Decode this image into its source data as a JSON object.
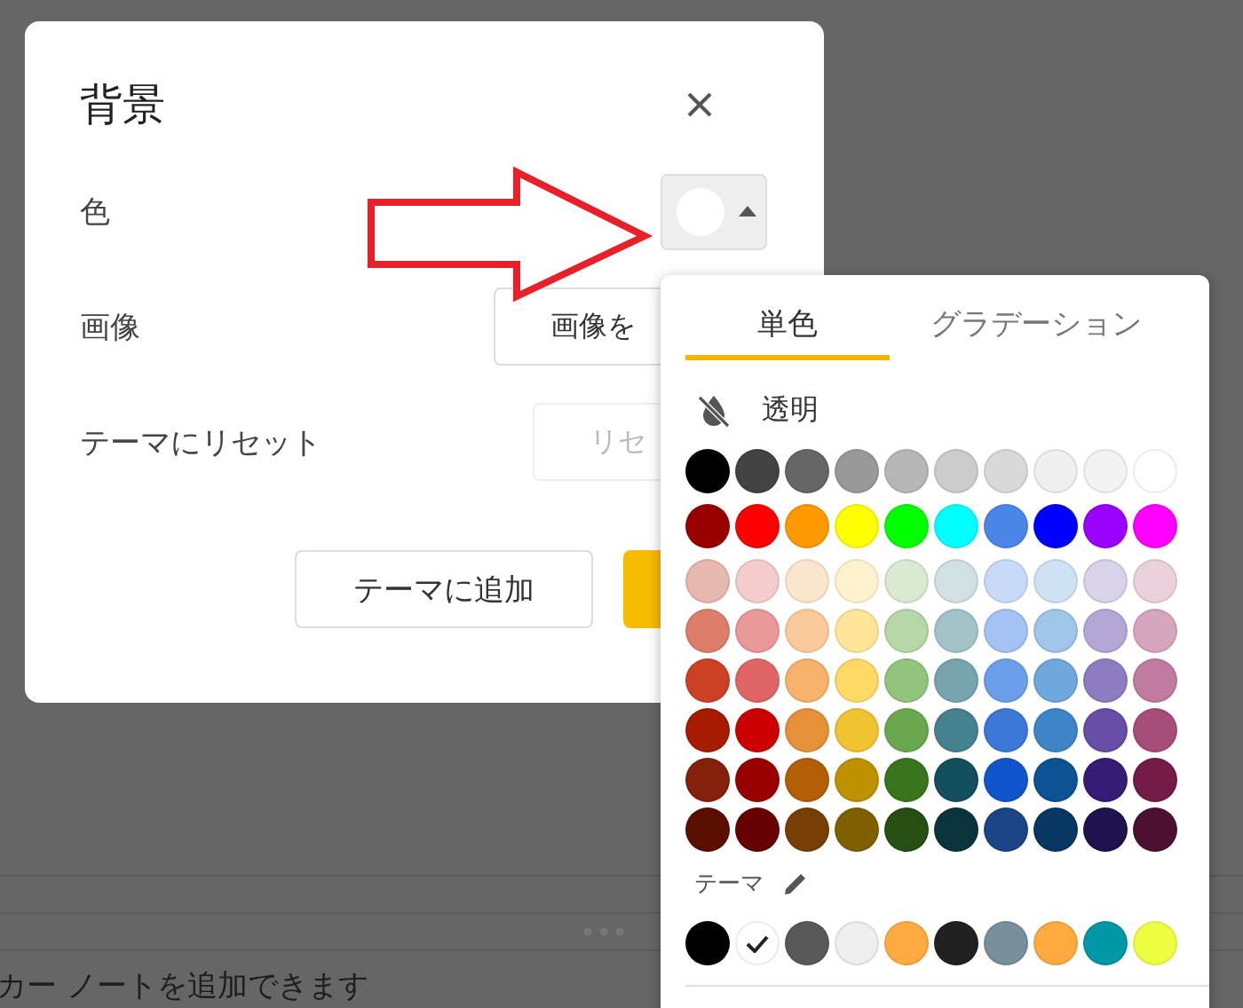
{
  "background_page": {
    "note_text": "カー ノートを追加できます"
  },
  "dialog": {
    "title": "背景",
    "rows": [
      {
        "kind": "color",
        "label": "色"
      },
      {
        "kind": "button",
        "label": "画像",
        "button": "画像を"
      },
      {
        "kind": "disabled-button",
        "label": "テーマにリセット",
        "button": "リセ"
      }
    ],
    "current_color": {
      "color": "#ffffff",
      "expanded": true
    },
    "footer_buttons": [
      {
        "label": "テーマに追加",
        "kind": "secondary"
      },
      {
        "kind": "primary"
      }
    ]
  },
  "palette": {
    "tabs": [
      {
        "label": "単色",
        "selected": true
      },
      {
        "label": "グラデーション",
        "selected": false
      }
    ],
    "transparent_label": "透明",
    "rows": [
      {
        "swatches": [
          {
            "color": "#000000"
          },
          {
            "color": "#434343"
          },
          {
            "color": "#666666"
          },
          {
            "color": "#999999"
          },
          {
            "color": "#b7b7b7"
          },
          {
            "color": "#cccccc"
          },
          {
            "color": "#d9d9d9"
          },
          {
            "color": "#efefef"
          },
          {
            "color": "#f3f3f3"
          },
          {
            "color": "#ffffff"
          }
        ]
      },
      {
        "swatches": [
          {
            "color": "#980000"
          },
          {
            "color": "#ff0000"
          },
          {
            "color": "#ff9900"
          },
          {
            "color": "#ffff00"
          },
          {
            "color": "#00ff00"
          },
          {
            "color": "#00ffff"
          },
          {
            "color": "#4a86e8"
          },
          {
            "color": "#0000ff"
          },
          {
            "color": "#9900ff"
          },
          {
            "color": "#ff00ff"
          }
        ]
      },
      {
        "swatches": [
          {
            "color": "#e6b8af"
          },
          {
            "color": "#f4cccc"
          },
          {
            "color": "#fce5cd"
          },
          {
            "color": "#fff2cc"
          },
          {
            "color": "#d9ead3"
          },
          {
            "color": "#d0e0e3"
          },
          {
            "color": "#c9daf8"
          },
          {
            "color": "#cfe2f3"
          },
          {
            "color": "#d9d2e9"
          },
          {
            "color": "#ead1dc"
          }
        ]
      },
      {
        "swatches": [
          {
            "color": "#dd7e6b"
          },
          {
            "color": "#ea9999"
          },
          {
            "color": "#f9cb9c"
          },
          {
            "color": "#ffe599"
          },
          {
            "color": "#b6d7a8"
          },
          {
            "color": "#a2c4c9"
          },
          {
            "color": "#a4c2f4"
          },
          {
            "color": "#9fc5e8"
          },
          {
            "color": "#b4a7d6"
          },
          {
            "color": "#d5a6bd"
          }
        ]
      },
      {
        "swatches": [
          {
            "color": "#cc4125"
          },
          {
            "color": "#e06666"
          },
          {
            "color": "#f6b26b"
          },
          {
            "color": "#ffd966"
          },
          {
            "color": "#93c47d"
          },
          {
            "color": "#76a5af"
          },
          {
            "color": "#6d9eeb"
          },
          {
            "color": "#6fa8dc"
          },
          {
            "color": "#8e7cc3"
          },
          {
            "color": "#c27ba0"
          }
        ]
      },
      {
        "swatches": [
          {
            "color": "#a61c00"
          },
          {
            "color": "#cc0000"
          },
          {
            "color": "#e69138"
          },
          {
            "color": "#f1c232"
          },
          {
            "color": "#6aa84f"
          },
          {
            "color": "#45818e"
          },
          {
            "color": "#3c78d8"
          },
          {
            "color": "#3d85c6"
          },
          {
            "color": "#674ea7"
          },
          {
            "color": "#a64d79"
          }
        ]
      },
      {
        "swatches": [
          {
            "color": "#85200c"
          },
          {
            "color": "#990000"
          },
          {
            "color": "#b45f06"
          },
          {
            "color": "#bf9000"
          },
          {
            "color": "#38761d"
          },
          {
            "color": "#134f5c"
          },
          {
            "color": "#1155cc"
          },
          {
            "color": "#0b5394"
          },
          {
            "color": "#351c75"
          },
          {
            "color": "#741b47"
          }
        ]
      },
      {
        "swatches": [
          {
            "color": "#5b0f00"
          },
          {
            "color": "#660000"
          },
          {
            "color": "#783f04"
          },
          {
            "color": "#7f6000"
          },
          {
            "color": "#274e13"
          },
          {
            "color": "#0c343d"
          },
          {
            "color": "#1c4587"
          },
          {
            "color": "#073763"
          },
          {
            "color": "#20124d"
          },
          {
            "color": "#4c1130"
          }
        ]
      }
    ],
    "theme_label": "テーマ",
    "theme_colors": [
      {
        "color": "#000000",
        "selected": false
      },
      {
        "color": "#ffffff",
        "selected": true
      },
      {
        "color": "#595959",
        "selected": false
      },
      {
        "color": "#eeeeee",
        "selected": false
      },
      {
        "color": "#ffab40",
        "selected": false
      },
      {
        "color": "#212121",
        "selected": false
      },
      {
        "color": "#78909c",
        "selected": false
      },
      {
        "color": "#ffab40",
        "selected": false
      },
      {
        "color": "#0097a7",
        "selected": false
      },
      {
        "color": "#eeff41",
        "selected": false
      }
    ]
  }
}
